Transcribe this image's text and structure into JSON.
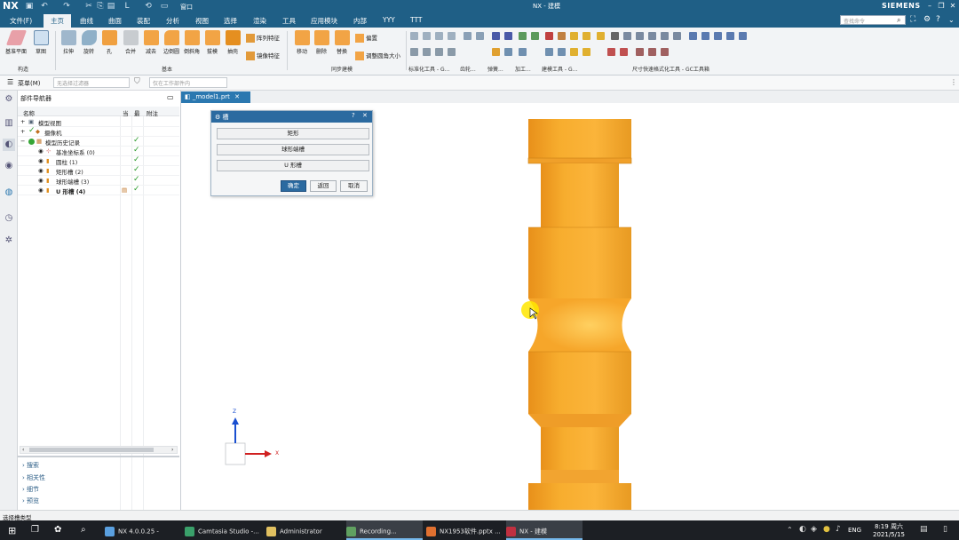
{
  "titlebar": {
    "logo": "NX",
    "title": "NX - 建模",
    "brand": "SIEMENS",
    "window_menu": "窗口"
  },
  "menubar": {
    "items": [
      "文件(F)",
      "主页",
      "曲线",
      "曲面",
      "装配",
      "分析",
      "视图",
      "选择",
      "渲染",
      "工具",
      "应用模块",
      "内部",
      "YYY",
      "TTT"
    ],
    "active": "主页",
    "search_placeholder": "查找命令"
  },
  "ribbon": {
    "buttons": [
      "基准平面",
      "草图",
      "拉伸",
      "旋转",
      "孔",
      "合并",
      "减去",
      "边倒圆",
      "倒斜角",
      "拔模",
      "抽壳",
      "移动",
      "删除",
      "替换",
      "偏置"
    ],
    "side_items": [
      "阵列特征",
      "镜像特征",
      "调整圆角大小"
    ],
    "groups": [
      "构造",
      "基本",
      "同步建模",
      "标准化工具 - G...",
      "齿轮...",
      "弹簧...",
      "加工...",
      "建模工具 - G...",
      "尺寸快速格式化工具 - GC工具箱"
    ]
  },
  "toolbar": {
    "menu_label": "菜单(M)",
    "filter_placeholder": "无选择过滤器",
    "scope_placeholder": "仅在工作部件内"
  },
  "navigator": {
    "title": "部件导航器",
    "columns": [
      "名称",
      "当",
      "最",
      "附注"
    ],
    "rows": [
      {
        "label": "模型视图",
        "indent": 0,
        "check": false
      },
      {
        "label": "摄像机",
        "indent": 0,
        "check": false
      },
      {
        "label": "模型历史记录",
        "indent": 0,
        "check": true
      },
      {
        "label": "基准坐标系 (0)",
        "indent": 1,
        "check": true
      },
      {
        "label": "圆柱 (1)",
        "indent": 1,
        "check": true
      },
      {
        "label": "矩形槽 (2)",
        "indent": 1,
        "check": true
      },
      {
        "label": "球形端槽 (3)",
        "indent": 1,
        "check": true
      },
      {
        "label": "U 形槽 (4)",
        "indent": 1,
        "check": true
      }
    ],
    "sections": [
      "搜索",
      "相关性",
      "细节",
      "预览"
    ]
  },
  "tab": {
    "label": "_model1.prt"
  },
  "dialog": {
    "title": "槽",
    "options": [
      "矩形",
      "球形端槽",
      "U 形槽"
    ],
    "ok": "确定",
    "back": "返回",
    "cancel": "取消"
  },
  "axes": {
    "z": "Z",
    "x": "X"
  },
  "statusbar": {
    "text": "选择槽类型"
  },
  "taskbar": {
    "tasks": [
      "NX 4.0.0.25 -",
      "Camtasia Studio -...",
      "Administrator",
      "Recording...",
      "NX1953软件.pptx ...",
      "NX - 建模"
    ],
    "lang": "ENG",
    "time": "8:19 周六",
    "date": "2021/5/15"
  },
  "colors": {
    "accent": "#1f5f86",
    "part": "#f5a21d",
    "cursor_highlight": "#ffe600"
  }
}
